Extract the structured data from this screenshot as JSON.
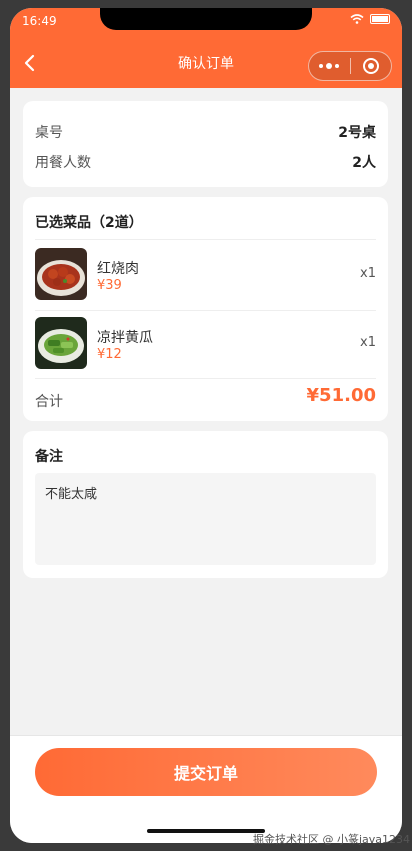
{
  "status_bar": {
    "time": "16:49"
  },
  "navbar": {
    "title": "确认订单"
  },
  "info": {
    "table_label": "桌号",
    "table_value": "2号桌",
    "diners_label": "用餐人数",
    "diners_value": "2人"
  },
  "dishes": {
    "title": "已选菜品（2道）",
    "items": [
      {
        "name": "红烧肉",
        "price": "¥39",
        "qty": "x1"
      },
      {
        "name": "凉拌黄瓜",
        "price": "¥12",
        "qty": "x1"
      }
    ],
    "total_label": "合计",
    "total_value": "¥51.00"
  },
  "note": {
    "title": "备注",
    "value": "不能太咸"
  },
  "submit_label": "提交订单",
  "watermark": "掘金技术社区 @ 小篆java1234",
  "colors": {
    "accent": "#ff6a35",
    "background": "#f2f2f2"
  }
}
